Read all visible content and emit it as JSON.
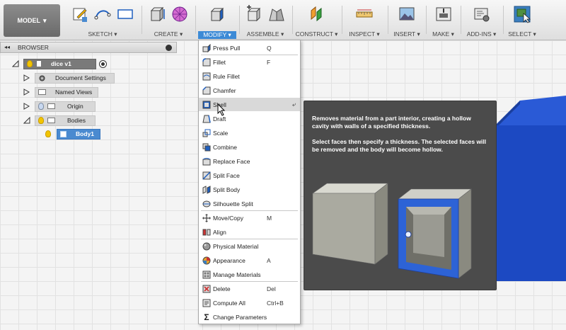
{
  "toolbar": {
    "model_label": "MODEL",
    "groups": [
      {
        "label": "SKETCH",
        "icons": [
          "sketch-create-icon",
          "arc-icon",
          "rectangle-icon"
        ]
      },
      {
        "label": "CREATE",
        "icons": [
          "extrude-icon",
          "form-icon"
        ]
      },
      {
        "label": "MODIFY",
        "icons": [
          "press-pull-icon"
        ]
      },
      {
        "label": "ASSEMBLE",
        "icons": [
          "new-component-icon",
          "joint-icon"
        ]
      },
      {
        "label": "CONSTRUCT",
        "icons": [
          "offset-plane-icon"
        ]
      },
      {
        "label": "INSPECT",
        "icons": [
          "measure-icon"
        ]
      },
      {
        "label": "INSERT",
        "icons": [
          "insert-image-icon"
        ]
      },
      {
        "label": "MAKE",
        "icons": [
          "3d-print-icon"
        ]
      },
      {
        "label": "ADD-INS",
        "icons": [
          "scripts-icon"
        ]
      },
      {
        "label": "SELECT",
        "icons": [
          "select-icon"
        ]
      }
    ]
  },
  "browser": {
    "title": "BROWSER",
    "root": "dice v1",
    "items": [
      "Document Settings",
      "Named Views",
      "Origin",
      "Bodies"
    ],
    "body": "Body1"
  },
  "menu": {
    "items": [
      {
        "label": "Press Pull",
        "key": "Q"
      },
      {
        "label": "Fillet",
        "key": "F"
      },
      {
        "label": "Rule Fillet",
        "key": ""
      },
      {
        "label": "Chamfer",
        "key": ""
      },
      {
        "label": "Shell",
        "key": ""
      },
      {
        "label": "Draft",
        "key": ""
      },
      {
        "label": "Scale",
        "key": ""
      },
      {
        "label": "Combine",
        "key": ""
      },
      {
        "label": "Replace Face",
        "key": ""
      },
      {
        "label": "Split Face",
        "key": ""
      },
      {
        "label": "Split Body",
        "key": ""
      },
      {
        "label": "Silhouette Split",
        "key": ""
      },
      {
        "label": "Move/Copy",
        "key": "M"
      },
      {
        "label": "Align",
        "key": ""
      },
      {
        "label": "Physical Material",
        "key": ""
      },
      {
        "label": "Appearance",
        "key": "A"
      },
      {
        "label": "Manage Materials",
        "key": ""
      },
      {
        "label": "Delete",
        "key": "Del"
      },
      {
        "label": "Compute All",
        "key": "Ctrl+B"
      },
      {
        "label": "Change Parameters",
        "key": ""
      }
    ]
  },
  "tooltip": {
    "line1": "Removes material from a part interior, creating a hollow cavity with walls of a specified thickness.",
    "line2": "Select faces then specify a thickness. The selected faces will be removed and the body will become hollow."
  },
  "colors": {
    "accent": "#3c8ad6",
    "body_blue": "#1f4fc8"
  }
}
